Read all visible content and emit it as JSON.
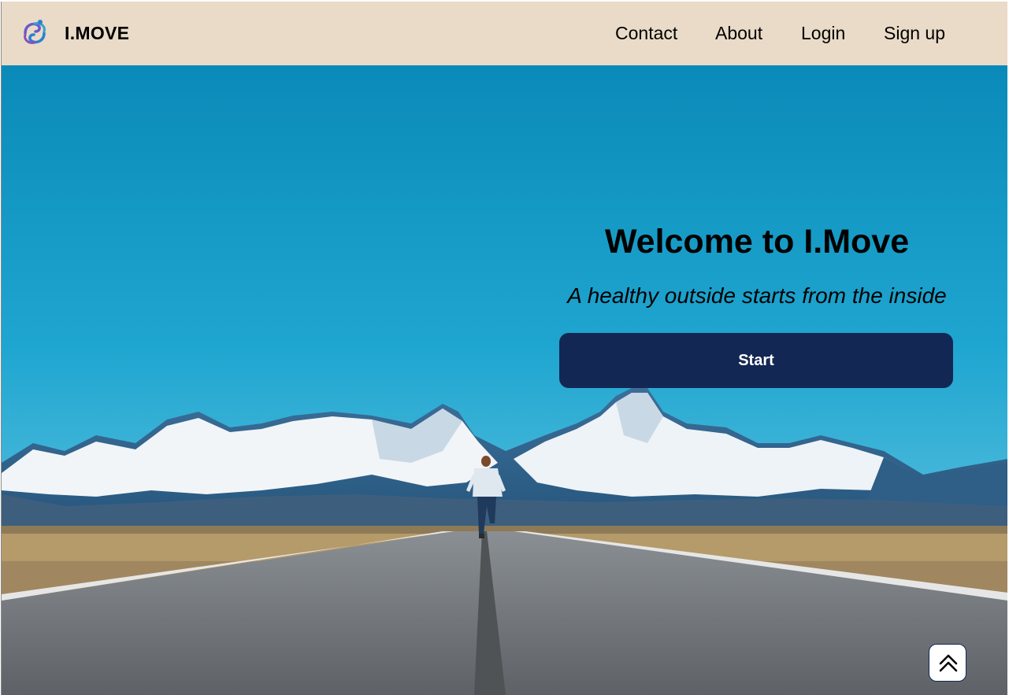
{
  "header": {
    "brand": "I.MOVE",
    "logo_icon": "runner-swirl-logo-icon",
    "nav": [
      {
        "label": "Contact"
      },
      {
        "label": "About"
      },
      {
        "label": "Login"
      },
      {
        "label": "Sign up"
      }
    ],
    "background_color": "#e9dbc7"
  },
  "hero": {
    "title": "Welcome to I.Move",
    "subtitle": "A healthy outside starts from the inside",
    "start_label": "Start",
    "button_color": "#132754",
    "image_subject": "runner-on-mountain-road-image"
  },
  "scroll_top": {
    "icon": "double-chevron-up-icon"
  }
}
